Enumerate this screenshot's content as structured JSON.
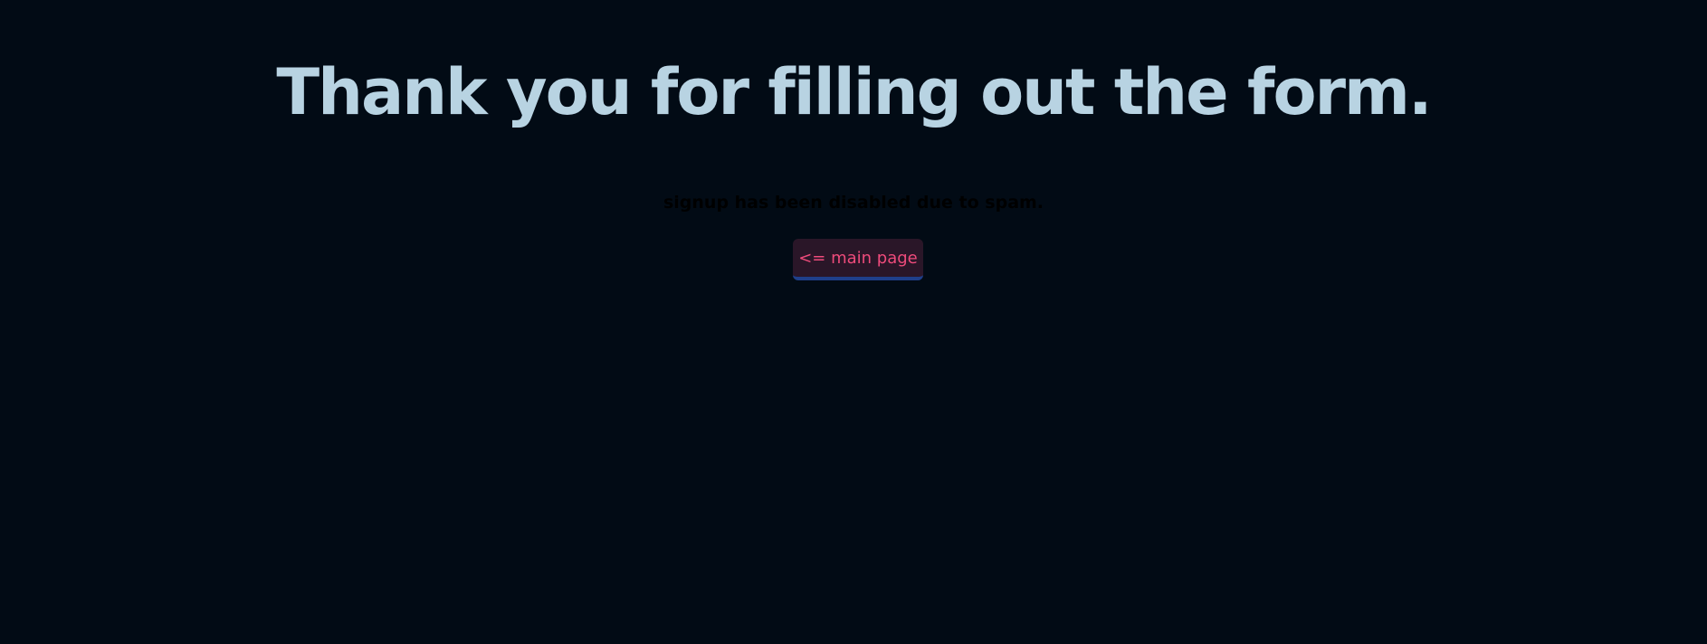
{
  "main": {
    "headline": "Thank you for filling out the form.",
    "notice": "signup has been disabled due to spam.",
    "back_button_label": "<= main page"
  },
  "colors": {
    "background": "#020b15",
    "headline": "#b8d3e2",
    "notice": "#000000",
    "button_bg": "#2a1628",
    "button_text": "#ee4b7b",
    "button_underline": "#1f3f8a"
  }
}
